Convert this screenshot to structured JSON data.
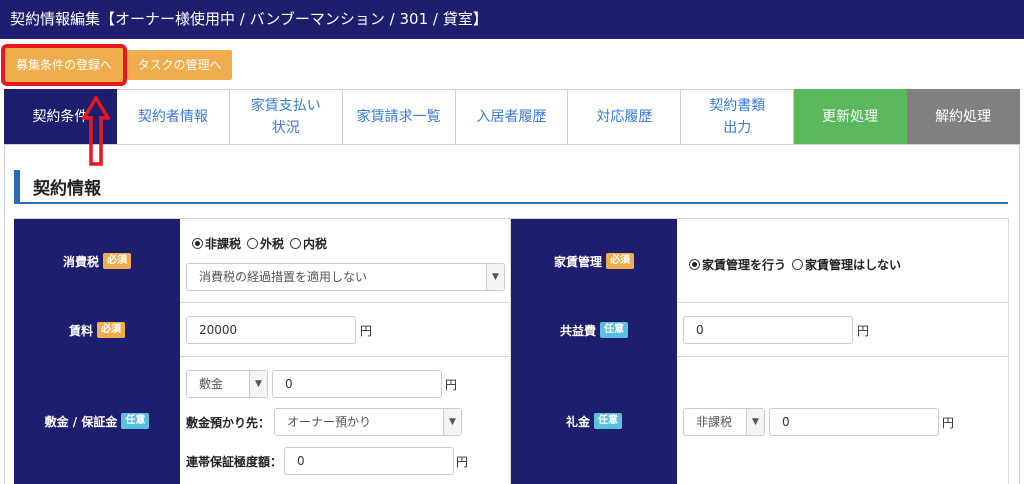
{
  "header": {
    "title": "契約情報編集【オーナー様使用中 / バンブーマンション / 301 / 貸室】"
  },
  "toolbar": {
    "recruit_label": "募集条件の登録へ",
    "task_label": "タスクの管理へ"
  },
  "tabs": [
    {
      "label": "契約条件"
    },
    {
      "label": "契約者情報"
    },
    {
      "label": "家賃支払い\n状況"
    },
    {
      "label": "家賃請求一覧"
    },
    {
      "label": "入居者履歴"
    },
    {
      "label": "対応履歴"
    },
    {
      "label": "契約書類\n出力"
    },
    {
      "label": "更新処理"
    },
    {
      "label": "解約処理"
    }
  ],
  "section": {
    "title": "契約情報"
  },
  "badges": {
    "required": "必須",
    "optional": "任意"
  },
  "unit": "円",
  "fields": {
    "tax": {
      "label": "消費税",
      "options": [
        "非課税",
        "外税",
        "内税"
      ],
      "selected": "非課税",
      "transition_select": "消費税の経過措置を適用しない"
    },
    "rent_management": {
      "label": "家賃管理",
      "options": [
        "家賃管理を行う",
        "家賃管理はしない"
      ],
      "selected": "家賃管理を行う"
    },
    "rent": {
      "label": "賃料",
      "value": "20000"
    },
    "common_fee": {
      "label": "共益費",
      "value": "0"
    },
    "deposit": {
      "label": "敷金 / 保証金",
      "type_select": "敷金",
      "value": "0",
      "holder_label": "敷金預かり先：",
      "holder_select": "オーナー預かり",
      "guarantee_label": "連帯保証極度額：",
      "guarantee_value": "0"
    },
    "key_money": {
      "label": "礼金",
      "tax_select": "非課税",
      "value": "0"
    }
  },
  "colors": {
    "navy": "#1e1e6e",
    "orange": "#f0ad4e",
    "green": "#5cb85c",
    "gray": "#808080",
    "info": "#5bc0de",
    "annotation_red": "#e8171f"
  }
}
